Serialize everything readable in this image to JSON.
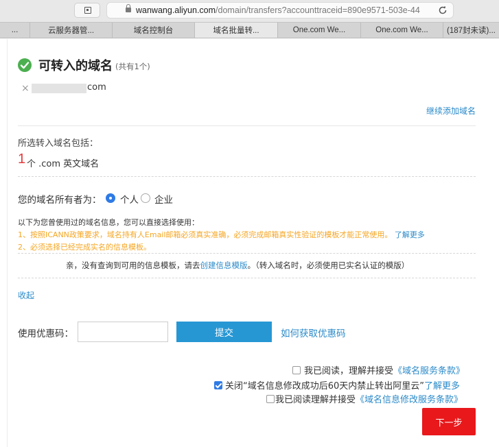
{
  "browser": {
    "url_host": "wanwang.aliyun.com",
    "url_path": "/domain/transfers?accounttraceid=890e9571-503e-44",
    "tabs": [
      {
        "label": "..."
      },
      {
        "label": "云服务器管..."
      },
      {
        "label": "域名控制台"
      },
      {
        "label": "域名批量转..."
      },
      {
        "label": "One.com We..."
      },
      {
        "label": "One.com We..."
      },
      {
        "label": "(187封未读)..."
      }
    ],
    "active_tab_index": 3
  },
  "page": {
    "title": "可转入的域名",
    "title_count": "(共有1个)",
    "domain_suffix": "com",
    "add_domain_link": "继续添加域名",
    "included_label": "所选转入域名包括：",
    "included_count": "1",
    "included_unit": "个 .com 英文域名",
    "owner_label": "您的域名所有者为：",
    "owner_options": [
      {
        "label": "个人",
        "selected": true
      },
      {
        "label": "企业",
        "selected": false
      }
    ],
    "info_intro": "以下为您曾使用过的域名信息，您可以直接选择使用：",
    "info_line_1": "1、按照ICANN政策要求，域名持有人Email邮箱必须真实准确，必须完成邮箱真实性验证的模板才能正常使用。",
    "info_line_1_link": "了解更多",
    "info_line_2": "2、必须选择已经完成实名的信息模板。",
    "notice_prefix": "亲，没有查询到可用的信息模板，请去",
    "notice_link": "创建信息模版",
    "notice_suffix": "。（转入域名时，必须使用已实名认证的模版）",
    "collapse_link": "收起",
    "coupon_label": "使用优惠码：",
    "coupon_value": "",
    "submit_label": "提交",
    "coupon_help_link": "如何获取优惠码",
    "agreements": [
      {
        "prefix": "我已阅读，理解并接受",
        "link": "《域名服务条款》",
        "suffix": "",
        "checked": false
      },
      {
        "prefix": "关闭“域名信息修改成功后60天内禁止转出阿里云”",
        "link": "了解更多",
        "suffix": "",
        "checked": true
      },
      {
        "prefix": "我已阅读理解并接受",
        "link": "《域名信息修改服务条款》",
        "suffix": "",
        "checked": false
      }
    ],
    "next_label": "下一步"
  },
  "colors": {
    "accent_blue": "#2a8ac9",
    "submit_blue": "#2797d4",
    "next_red": "#e8181b",
    "warning_orange": "#f5a623",
    "success_green": "#4caf50"
  }
}
